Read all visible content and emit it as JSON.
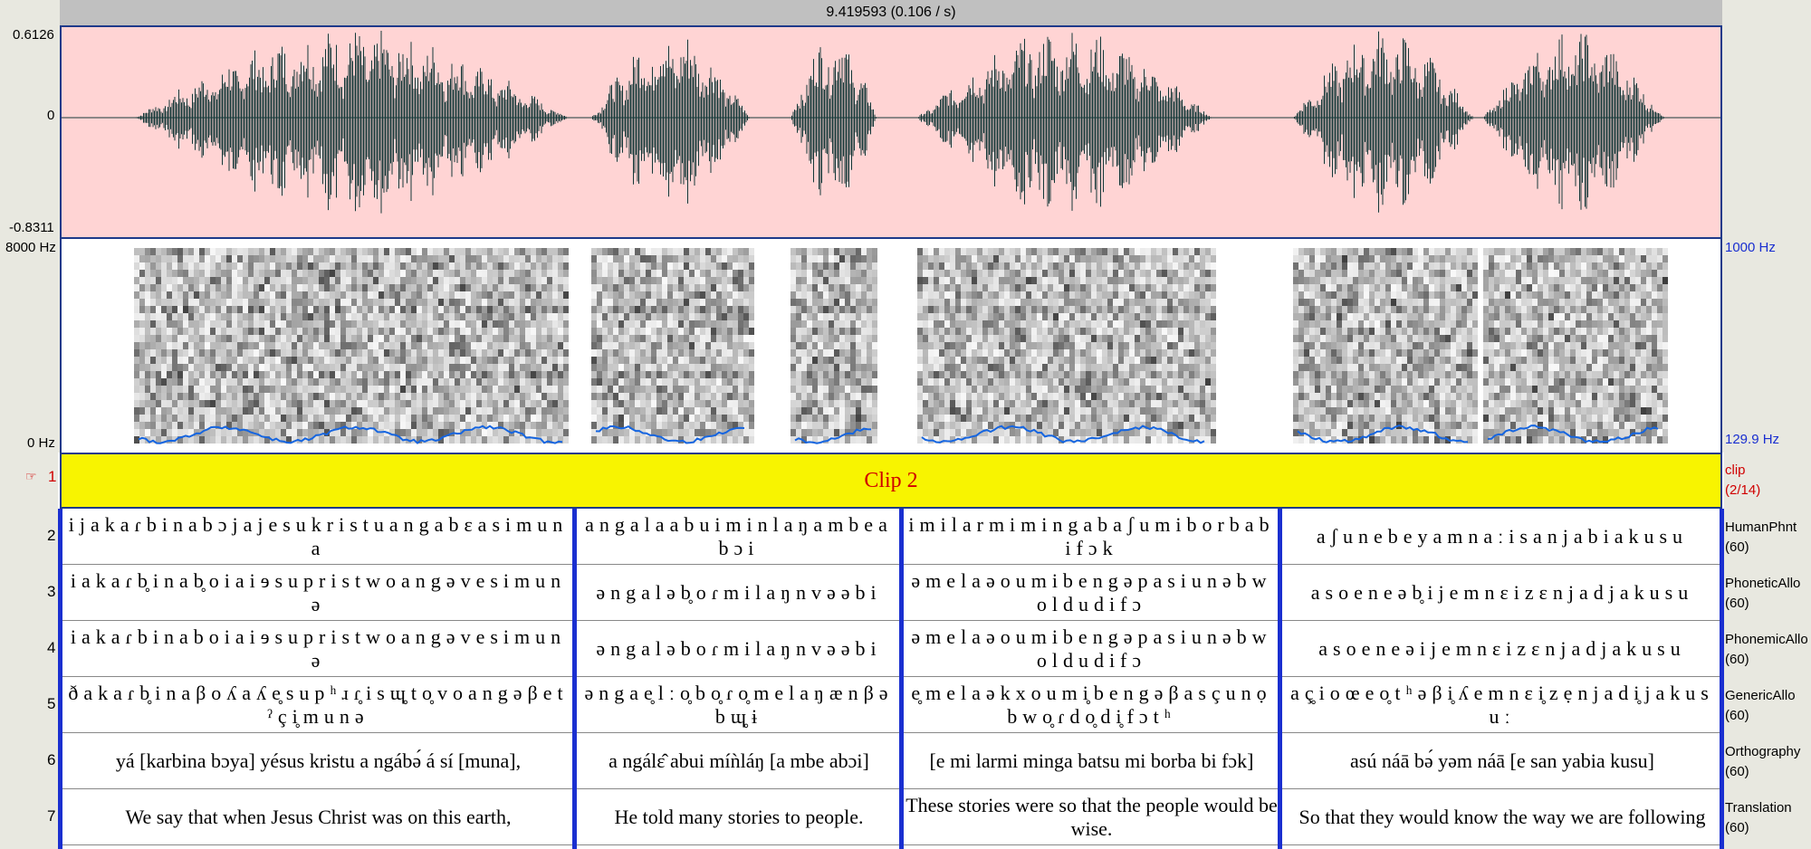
{
  "header": {
    "title": "9.419593 (0.106 / s)"
  },
  "waveform": {
    "max_label": "0.6126",
    "zero_label": "0",
    "min_label": "-0.8311"
  },
  "spectrogram": {
    "top_label": "8000 Hz",
    "bottom_label": "0 Hz",
    "pitch_top_label": "1000 Hz",
    "pitch_bottom_label": "129.9 Hz"
  },
  "clip_tier": {
    "number": "1",
    "pointer_icon": "hand-pointer-icon",
    "label": "Clip 2",
    "name": "clip",
    "count": "(2/14)"
  },
  "tiers": [
    {
      "number": "2",
      "name": "HumanPhnt",
      "count": "(60)",
      "ipa": true,
      "cells": [
        "ijakaɾbinabɔjajesukristuangabɛasimuna",
        "angalaabuiminlaŋambeabɔi",
        "imilarmimingabaʃumiborbabifɔk",
        "aʃunebeyamnaːisanjabiakusu"
      ]
    },
    {
      "number": "3",
      "name": "PhoneticAllo",
      "count": "(60)",
      "ipa": true,
      "cells": [
        "iakaɾb̥inab̥oiaiɘsupristwoangəvesimunə",
        "əngaləb̥oɾmilaŋnvəəbi",
        "əmelaəoumibengəpasiunəbwoldudifɔ",
        "asoeneəb̥ijemnɛizɛnjadjakusu"
      ]
    },
    {
      "number": "4",
      "name": "PhonemicAllo",
      "count": "(60)",
      "ipa": true,
      "cells": [
        "iakaɾbinaboiaiɘsupristwoangəvesimunə",
        "əngaləboɾmilaŋnvəəbi",
        "əmelaəoumibengəpasiunəbwoldudifɔ",
        "asoeneəijemnɛizɛnjadjakusu"
      ]
    },
    {
      "number": "5",
      "name": "GenericAllo",
      "count": "(60)",
      "ipa": true,
      "cells": [
        "ðakaɾb̥inaβoʎaʎe̥supʰɹɾ̥isɰ̥to̥voangəβetˀçi̥munə",
        "əngae̥lːo̥bo̥ɾo̥melaŋænβəbɰ̥ɨ",
        "e̥melaəkxoumi̥bengəβasçunọbwo̥ɾdo̥di̥fɔtʰ",
        "aç̥ioœeo̥tʰəβi̥ʎemnɛi̥zẹnjadi̥jakusuː"
      ]
    },
    {
      "number": "6",
      "name": "Orthography",
      "count": "(60)",
      "ipa": false,
      "cells": [
        "yá [karbina bɔya] yésus kristu a ngábə́ á sí [muna],",
        "a ngálɛ̂ abui míǹláŋ [a mbe abɔi]",
        "[e mi larmi minga batsu mi borba bi fɔk]",
        "asú náā bə́ yəm náā [e san yabia kusu]"
      ]
    },
    {
      "number": "7",
      "name": "Translation",
      "count": "(60)",
      "ipa": false,
      "cells": [
        "We say that when Jesus Christ was on this earth,",
        "He told many stories to people.",
        "These stories were so that the people would be wise.",
        "So that they would know the way we are following"
      ]
    }
  ]
}
